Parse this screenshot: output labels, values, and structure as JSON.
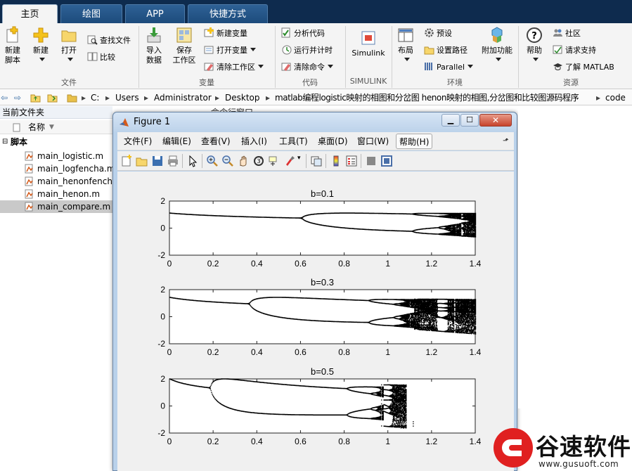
{
  "tabs": [
    "主页",
    "绘图",
    "APP",
    "快捷方式"
  ],
  "ribbon": {
    "file": {
      "label": "文件",
      "new_script": [
        "新建",
        "脚本"
      ],
      "new": "新建",
      "open": "打开",
      "find_files": "查找文件",
      "compare": "比较"
    },
    "variable": {
      "label": "变量",
      "import": [
        "导入",
        "数据"
      ],
      "save_ws": [
        "保存",
        "工作区"
      ],
      "new_var": "新建变量",
      "open_var": "打开变量",
      "clear_ws": "清除工作区"
    },
    "code": {
      "label": "代码",
      "analyze": "分析代码",
      "run_time": "运行并计时",
      "clear_cmd": "清除命令"
    },
    "simulink": {
      "label": "SIMULINK",
      "btn": "Simulink"
    },
    "env": {
      "label": "环境",
      "layout": "布局",
      "prefs": "预设",
      "set_path": "设置路径",
      "parallel": "Parallel",
      "addons": "附加功能"
    },
    "resources": {
      "label": "资源",
      "help": "帮助",
      "community": "社区",
      "support": "请求支持",
      "learn": "了解 MATLAB"
    }
  },
  "address": {
    "crumbs": [
      "C:",
      "Users",
      "Administrator",
      "Desktop",
      "matlab编程logistic映射的相图和分岔图 henon映射的相图,分岔图和比较图源码程序",
      "code"
    ]
  },
  "current_folder": {
    "title": "当前文件夹",
    "col_name": "名称",
    "group": "脚本",
    "files": [
      "main_logistic.m",
      "main_logfencha.m",
      "main_henonfencha.m",
      "main_henon.m",
      "main_compare.m"
    ],
    "selected": 4
  },
  "behind_text": "命令行窗口",
  "figure": {
    "title": "Figure 1",
    "menus": [
      "文件(F)",
      "编辑(E)",
      "查看(V)",
      "插入(I)",
      "工具(T)",
      "桌面(D)",
      "窗口(W)",
      "帮助(H)"
    ],
    "toolbar_icons": [
      "new-figure-icon",
      "open-file-icon",
      "save-icon",
      "print-icon",
      "pointer-icon",
      "zoom-in-icon",
      "zoom-out-icon",
      "pan-icon",
      "rotate-icon",
      "data-cursor-icon",
      "brush-icon",
      "link-icon",
      "colorbar-icon",
      "legend-icon",
      "hide-plot-tools-icon",
      "show-plot-tools-icon"
    ]
  },
  "chart_data": [
    {
      "type": "scatter",
      "title": "b=0.1",
      "b": 0.1,
      "xlim": [
        0,
        1.4
      ],
      "ylim": [
        -2,
        2
      ],
      "xticks": [
        "0",
        "0.2",
        "0.4",
        "0.6",
        "0.8",
        "1",
        "1.2",
        "1.4"
      ],
      "yticks": [
        "2",
        "0",
        "-2"
      ],
      "series": [
        {
          "values_desc": "bifurcation of Henon map x vs a"
        }
      ]
    },
    {
      "type": "scatter",
      "title": "b=0.3",
      "b": 0.3,
      "xlim": [
        0,
        1.4
      ],
      "ylim": [
        -2,
        2
      ],
      "xticks": [
        "0",
        "0.2",
        "0.4",
        "0.6",
        "0.8",
        "1",
        "1.2",
        "1.4"
      ],
      "yticks": [
        "2",
        "0",
        "-2"
      ]
    },
    {
      "type": "scatter",
      "title": "b=0.5",
      "b": 0.5,
      "xlim": [
        0,
        1.4
      ],
      "ylim": [
        -2,
        2
      ],
      "xticks": [
        "0",
        "0.2",
        "0.4",
        "0.6",
        "0.8",
        "1",
        "1.2",
        "1.4"
      ],
      "yticks": [
        "2",
        "0",
        "-2"
      ]
    }
  ],
  "watermark": {
    "name": "谷速软件",
    "url": "www.gusuoft.com",
    "color": "#e02020"
  }
}
